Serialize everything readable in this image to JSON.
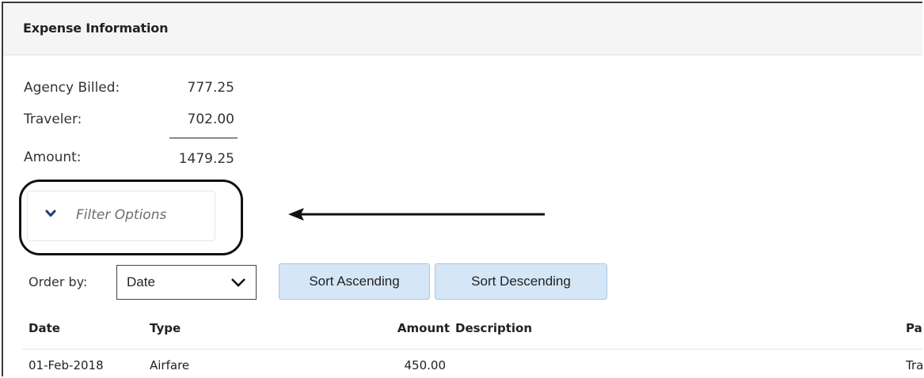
{
  "panel": {
    "title": "Expense Information"
  },
  "summary": {
    "agency_billed_label": "Agency Billed:",
    "agency_billed_value": "777.25",
    "traveler_label": "Traveler:",
    "traveler_value": "702.00",
    "amount_label": "Amount:",
    "amount_value": "1479.25"
  },
  "filter": {
    "label": "Filter Options",
    "icon": "chevron-down-icon",
    "expanded": false
  },
  "order": {
    "label": "Order by:",
    "selected": "Date",
    "sort_ascending_label": "Sort Ascending",
    "sort_descending_label": "Sort Descending"
  },
  "table": {
    "columns": [
      "Date",
      "Type",
      "Amount",
      "Description",
      "Pa"
    ],
    "rows": [
      [
        "01-Feb-2018",
        "Airfare",
        "450.00",
        "",
        "Tra"
      ]
    ]
  },
  "colors": {
    "button_bg": "#d5e6f7",
    "button_border": "#a7c7e8",
    "header_bg": "#f5f5f5",
    "annotation": "#111111"
  }
}
